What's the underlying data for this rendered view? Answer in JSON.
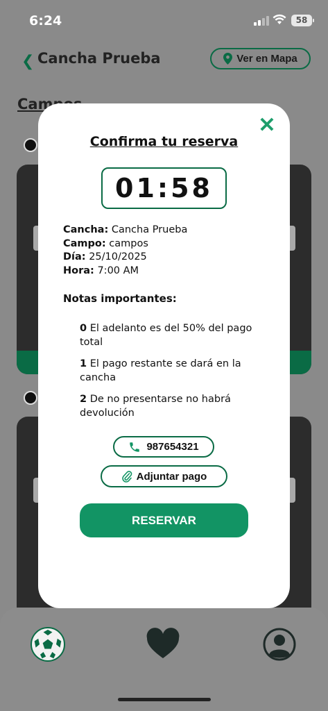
{
  "status_bar": {
    "time": "6:24",
    "battery": "58"
  },
  "header": {
    "title": "Cancha Prueba",
    "back_icon": "chevron-left-icon",
    "map_button_label": "Ver en Mapa",
    "map_icon": "map-pin-icon"
  },
  "section": {
    "title": "Campos"
  },
  "modal": {
    "title": "Confirma tu reserva",
    "close_icon": "close-icon",
    "timer": "01:58",
    "details": [
      {
        "label": "Cancha:",
        "value": "Cancha Prueba"
      },
      {
        "label": "Campo:",
        "value": "campos"
      },
      {
        "label": "Día:",
        "value": "25/10/2025"
      },
      {
        "label": "Hora:",
        "value": "7:00 AM"
      }
    ],
    "notes_title": "Notas importantes:",
    "notes": [
      {
        "number": "0",
        "text": "El adelanto es del 50% del pago total"
      },
      {
        "number": "1",
        "text": "El pago restante se dará en la cancha"
      },
      {
        "number": "2",
        "text": "De no presentarse no habrá devolución"
      }
    ],
    "phone": "987654321",
    "attach_label": "Adjuntar pago",
    "reserve_label": "RESERVAR"
  },
  "bottom_nav": {
    "items": [
      "soccer-ball-icon",
      "heart-icon",
      "profile-icon"
    ]
  },
  "colors": {
    "accent": "#129464",
    "accent_dark": "#0a6b45",
    "overlay": "#8a8a8a"
  }
}
